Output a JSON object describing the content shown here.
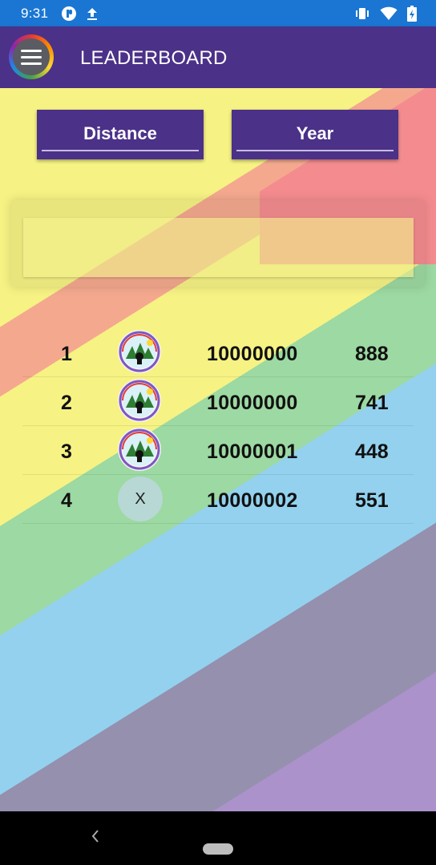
{
  "status_bar": {
    "time": "9:31",
    "icons": [
      "app-notification-icon",
      "upload-icon",
      "vibrate-icon",
      "wifi-icon",
      "battery-charging-icon"
    ]
  },
  "app_bar": {
    "title": "LEADERBOARD",
    "menu_icon": "hamburger-menu-icon"
  },
  "filters": {
    "distance_label": "Distance",
    "year_label": "Year"
  },
  "search": {
    "value": ""
  },
  "leaderboard": {
    "rows": [
      {
        "rank": "1",
        "avatar": "profile-image",
        "score": "10000000",
        "value": "888"
      },
      {
        "rank": "2",
        "avatar": "profile-image",
        "score": "10000000",
        "value": "741"
      },
      {
        "rank": "3",
        "avatar": "profile-image",
        "score": "10000001",
        "value": "448"
      },
      {
        "rank": "4",
        "avatar_text": "X",
        "score": "10000002",
        "value": "551"
      }
    ]
  },
  "colors": {
    "status_bar": "#1a76d2",
    "app_bar": "#4b3188",
    "button": "#4b3188"
  }
}
